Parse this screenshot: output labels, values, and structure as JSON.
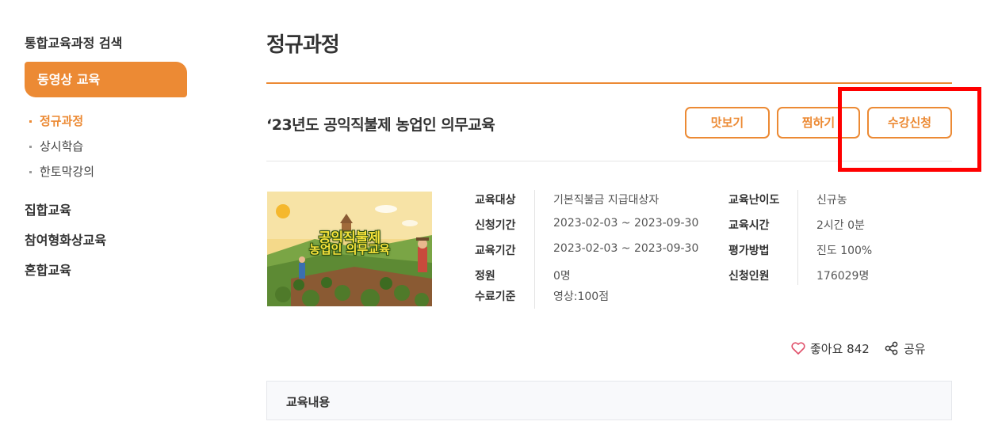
{
  "sidebar": {
    "search_label": "통합교육과정 검색",
    "active_item": "동영상 교육",
    "sub_items": [
      {
        "label": "정규과정",
        "active": true
      },
      {
        "label": "상시학습",
        "active": false
      },
      {
        "label": "한토막강의",
        "active": false
      }
    ],
    "main_items": [
      "집합교육",
      "참여형화상교육",
      "혼합교육"
    ]
  },
  "page": {
    "title": "정규과정"
  },
  "course": {
    "title": "‘23년도 공익직불제 농업인 의무교육",
    "thumbnail_text_1": "공익직불제",
    "thumbnail_text_2": "농업인 의무교육",
    "buttons": {
      "preview": "맛보기",
      "wishlist": "찜하기",
      "enroll": "수강신청"
    },
    "info_left": [
      {
        "label": "교육대상",
        "value": "기본직불금 지급대상자"
      },
      {
        "label": "신청기간",
        "value": "2023-02-03 ~ 2023-09-30"
      },
      {
        "label": "교육기간",
        "value": "2023-02-03 ~ 2023-09-30"
      },
      {
        "label": "정원",
        "value": "0명"
      },
      {
        "label": "수료기준",
        "value": "영상:100점"
      }
    ],
    "info_right": [
      {
        "label": "교육난이도",
        "value": "신규농"
      },
      {
        "label": "교육시간",
        "value": "2시간 0분"
      },
      {
        "label": "평가방법",
        "value": "진도 100%"
      },
      {
        "label": "신청인원",
        "value": "176029명"
      }
    ],
    "like_label": "좋아요 842",
    "share_label": "공유",
    "content_label": "교육내용"
  },
  "colors": {
    "accent": "#ec8a34",
    "highlight": "#ff0000"
  }
}
